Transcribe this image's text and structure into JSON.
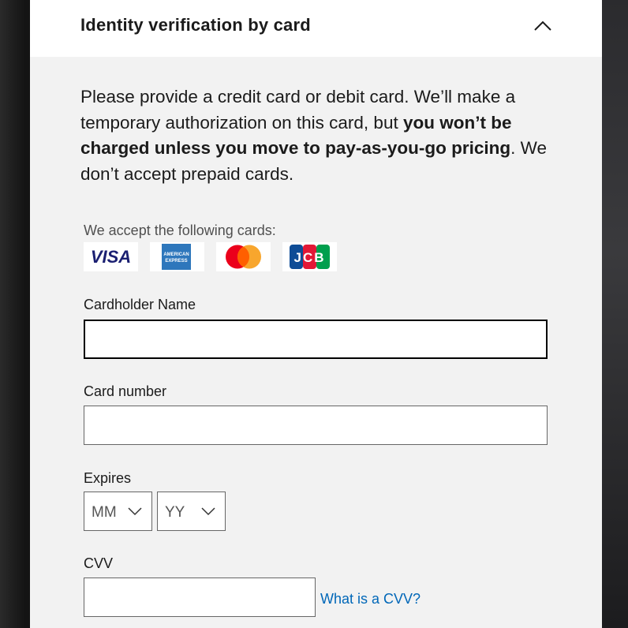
{
  "panel": {
    "title": "Identity verification by card",
    "collapse_icon": "chevron-up-icon"
  },
  "intro": {
    "text_before": "Please provide a credit card or debit card. We’ll make a temporary authorization on this card, but ",
    "text_bold": "you won’t be charged unless you move to pay-as-you-go pricing",
    "text_after": ". We don’t accept prepaid cards."
  },
  "accepted_cards": {
    "label": "We accept the following cards:",
    "cards": [
      "VISA",
      "AMERICAN EXPRESS",
      "Mastercard",
      "JCB"
    ],
    "visa_text": "VISA",
    "amex_text_1": "AMERICAN",
    "amex_text_2": "EXPRESS",
    "jcb_text": "JCB"
  },
  "form": {
    "cardholder_label": "Cardholder Name",
    "cardholder_value": "",
    "card_number_label": "Card number",
    "card_number_value": "",
    "expires_label": "Expires",
    "month_value": "MM",
    "year_value": "YY",
    "cvv_label": "CVV",
    "cvv_value": "",
    "cvv_help_link": "What is a CVV?"
  },
  "colors": {
    "panel_bg": "#f2f2f2",
    "header_bg": "#ffffff",
    "link": "#0067b8",
    "visa_blue": "#1a1f71",
    "amex_blue": "#2e77bc",
    "mc_red": "#eb001b",
    "mc_orange": "#f79e1b"
  }
}
